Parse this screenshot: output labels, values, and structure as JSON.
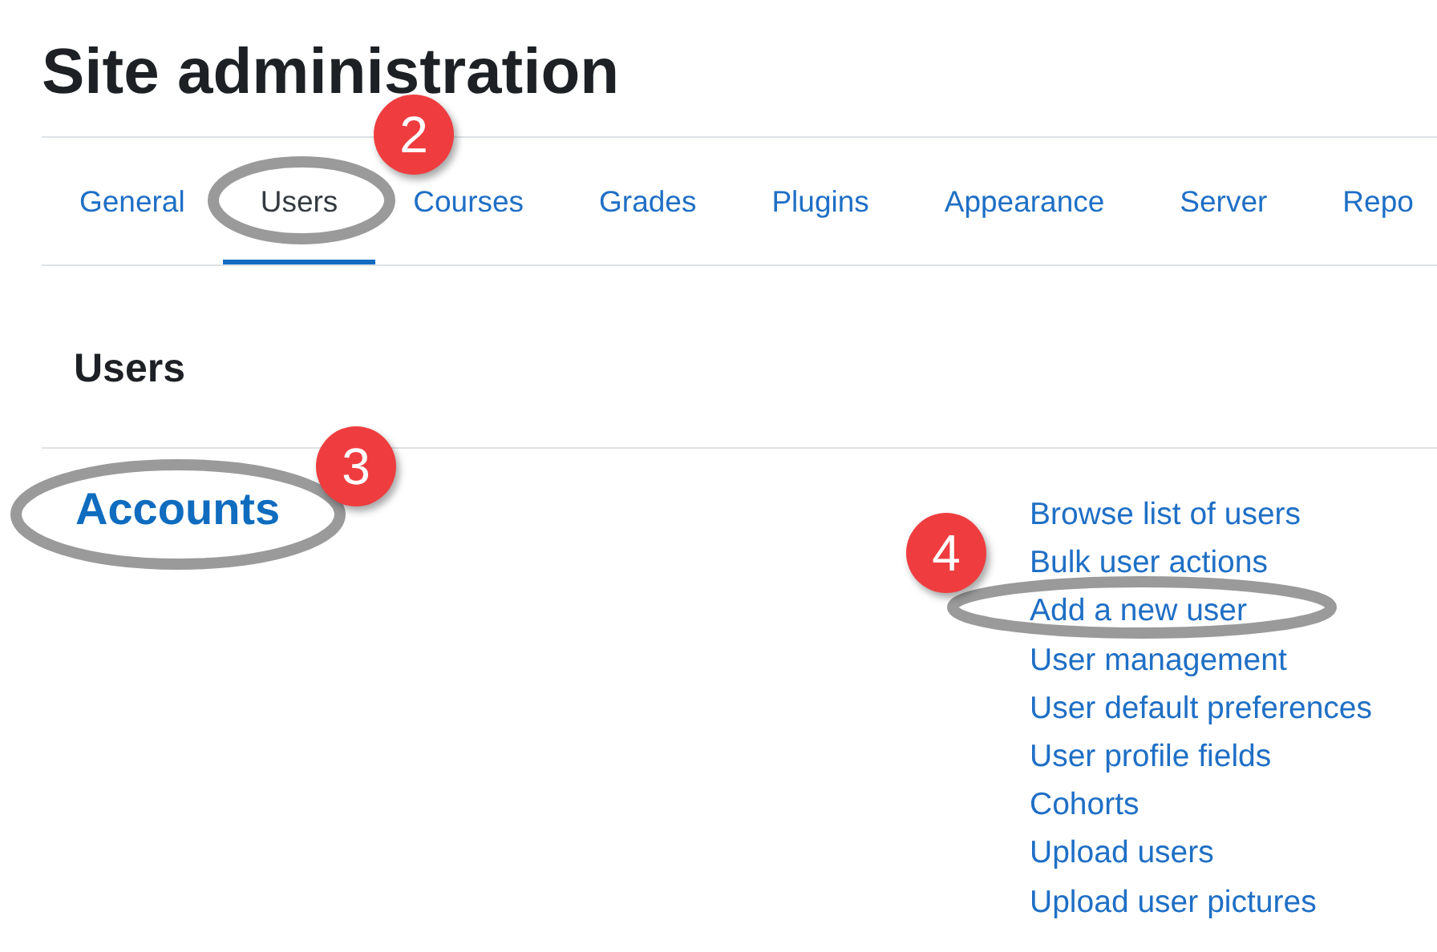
{
  "page_title": "Site administration",
  "tabs": [
    {
      "label": "General",
      "selected": false
    },
    {
      "label": "Users",
      "selected": true
    },
    {
      "label": "Courses",
      "selected": false
    },
    {
      "label": "Grades",
      "selected": false
    },
    {
      "label": "Plugins",
      "selected": false
    },
    {
      "label": "Appearance",
      "selected": false
    },
    {
      "label": "Server",
      "selected": false
    },
    {
      "label": "Repo",
      "selected": false
    }
  ],
  "section_heading": "Users",
  "category": {
    "title": "Accounts",
    "links": [
      "Browse list of users",
      "Bulk user actions",
      "Add a new user",
      "User management",
      "User default preferences",
      "User profile fields",
      "Cohorts",
      "Upload users",
      "Upload user pictures"
    ]
  },
  "callouts": [
    {
      "number": "2"
    },
    {
      "number": "3"
    },
    {
      "number": "4"
    }
  ]
}
